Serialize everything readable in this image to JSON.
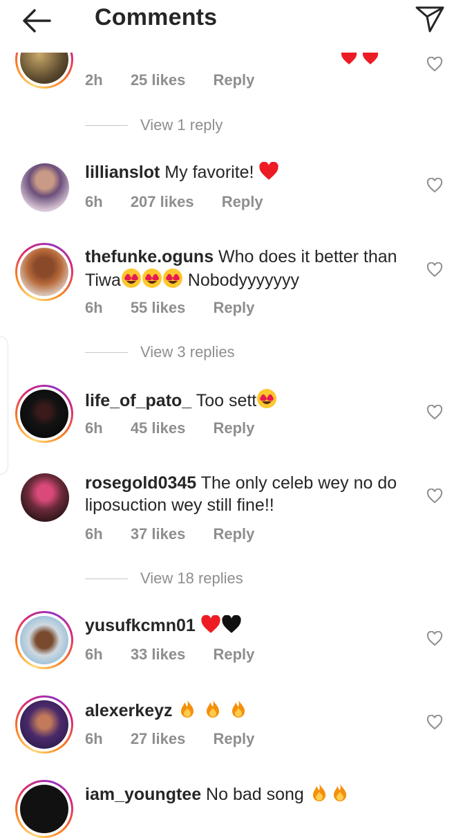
{
  "header": {
    "title": "Comments"
  },
  "comments": [
    {
      "username": "",
      "text": "",
      "time": "2h",
      "likes": "25 likes",
      "reply": "Reply"
    },
    {
      "username": "lillianslot",
      "text": " My favorite!",
      "time": "6h",
      "likes": "207 likes",
      "reply": "Reply"
    },
    {
      "username": "thefunke.oguns",
      "text": " Who does it better than Tiwa",
      "text2": " Nobodyyyyyyy",
      "time": "6h",
      "likes": "55 likes",
      "reply": "Reply"
    },
    {
      "username": "life_of_pato_",
      "text": " Too sett",
      "time": "6h",
      "likes": "45 likes",
      "reply": "Reply"
    },
    {
      "username": "rosegold0345",
      "text": " The only celeb wey no do liposuction wey still fine!!",
      "time": "6h",
      "likes": "37 likes",
      "reply": "Reply"
    },
    {
      "username": "yusufkcmn01",
      "text": " ",
      "time": "6h",
      "likes": "33 likes",
      "reply": "Reply"
    },
    {
      "username": "alexerkeyz",
      "text": " ",
      "time": "6h",
      "likes": "27 likes",
      "reply": "Reply"
    },
    {
      "username": "iam_youngtee",
      "text": " No bad song"
    }
  ],
  "view_replies": [
    "View 1 reply",
    "View 3 replies",
    "View 18 replies"
  ],
  "colors": {
    "text": "#262626",
    "muted": "#8e8e8e",
    "heart_red": "#ed1c24"
  }
}
